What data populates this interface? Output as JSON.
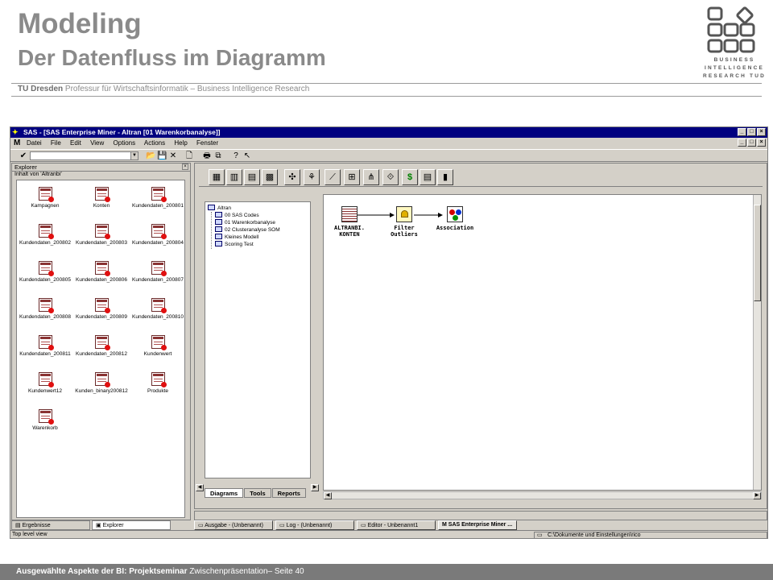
{
  "slide": {
    "title": "Modeling",
    "subtitle": "Der Datenfluss im Diagramm",
    "affiliation_bold": "TU Dresden",
    "affiliation_rest": " Professur für Wirtschaftsinformatik – Business Intelligence Research",
    "logo_lines": [
      "BUSINESS",
      "INTELLIGENCE",
      "RESEARCH TUD"
    ],
    "footer_bold": "Ausgewählte Aspekte der BI: Projektseminar",
    "footer_rest": " Zwischenpräsentation– Seite 40"
  },
  "window": {
    "title": "SAS - [SAS Enterprise Miner - Altran [01 Warenkorbanalyse]]",
    "controls": [
      "_",
      "□",
      "×"
    ],
    "menu": [
      "Datei",
      "File",
      "Edit",
      "View",
      "Options",
      "Actions",
      "Help",
      "Fenster"
    ],
    "command_value": ""
  },
  "explorer": {
    "header": "Explorer",
    "subheader": "Inhalt von 'Altranbi'",
    "datasets": [
      "Kampagnen",
      "Konten",
      "Kundendaten_200801",
      "Kundendaten_200802",
      "Kundendaten_200803",
      "Kundendaten_200804",
      "Kundendaten_200805",
      "Kundendaten_200806",
      "Kundendaten_200807",
      "Kundendaten_200808",
      "Kundendaten_200809",
      "Kundendaten_200810",
      "Kundendaten_200811",
      "Kundendaten_200812",
      "Kundenwert",
      "Kundenwert12",
      "Kunden_binary200812",
      "Produkte",
      "Warenkorb"
    ]
  },
  "project": {
    "root": "Altran",
    "items": [
      "00 SAS Codes",
      "01 Warenkorbanalyse",
      "02 Clusteranalyse SOM",
      "Kleines Modell",
      "Scoring Test"
    ],
    "tabs": [
      "Diagrams",
      "Tools",
      "Reports"
    ]
  },
  "diagram": {
    "nodes": [
      {
        "label1": "ALTRANBI.",
        "label2": "KONTEN"
      },
      {
        "label1": "Filter",
        "label2": "Outliers"
      },
      {
        "label1": "Association",
        "label2": ""
      }
    ]
  },
  "bottom": {
    "left_tabs": [
      "Ergebnisse",
      "Explorer"
    ],
    "task_tabs": [
      "Ausgabe - (Unbenannt)",
      "Log - (Unbenannt)",
      "Editor - Unbenannt1",
      "SAS Enterprise Miner ..."
    ],
    "status_left": "Top level view",
    "status_right": "C:\\Dokumente und Einstellungen\\rico"
  }
}
